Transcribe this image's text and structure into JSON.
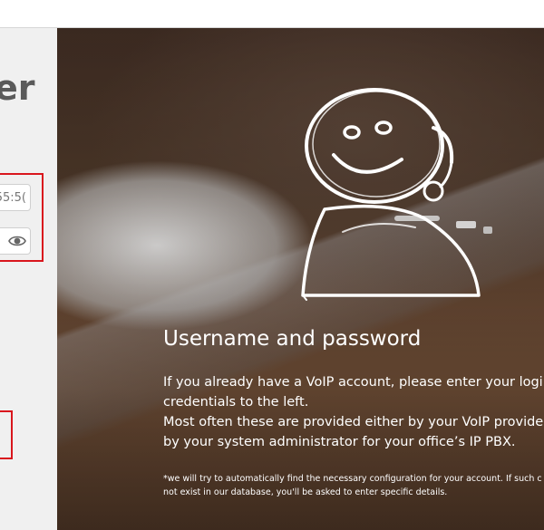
{
  "form": {
    "title_fragment": "er",
    "server_field_value": "55:5("
  },
  "hero": {
    "heading": "Username and password",
    "paragraph_lines": [
      "If you already have a VoIP account, please enter your login",
      "credentials to the left.",
      "Most often these are provided either by your VoIP provider,",
      "by your system administrator for your office’s IP PBX."
    ],
    "note_lines": [
      "*we will try to automatically find the necessary configuration for your account. If such c",
      "not exist in our database, you'll be asked to enter specific details."
    ]
  },
  "icons": {
    "password_toggle": "eye-icon",
    "illustration": "headset-support-agent-icon"
  },
  "colors": {
    "highlight": "#d9161d",
    "panel_background": "#f0f0f0"
  }
}
